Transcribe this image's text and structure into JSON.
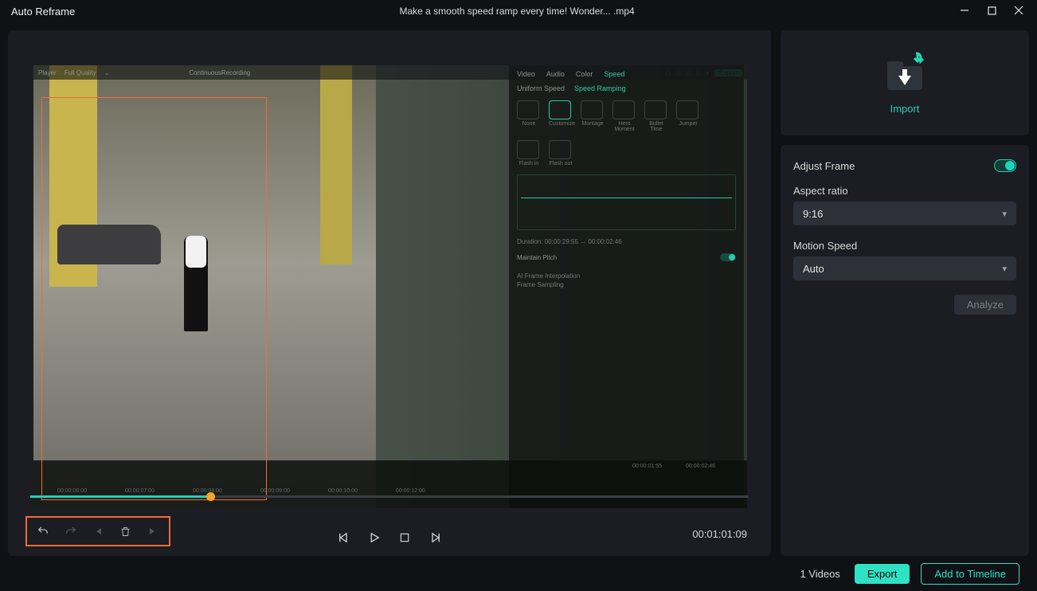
{
  "titlebar": {
    "app": "Auto Reframe",
    "filename": "Make a smooth speed ramp every time!  Wonder... .mp4"
  },
  "import": {
    "label": "Import"
  },
  "settings": {
    "adjust_frame_label": "Adjust Frame",
    "aspect_ratio_label": "Aspect ratio",
    "aspect_ratio_value": "9:16",
    "motion_speed_label": "Motion Speed",
    "motion_speed_value": "Auto",
    "analyze_label": "Analyze"
  },
  "playback": {
    "timecode": "00:01:01:09"
  },
  "inner_panel": {
    "top_left": "ContinuousRecording",
    "player_label": "Player",
    "quality_label": "Full Quality",
    "export_label": "Export",
    "tabs": {
      "video": "Video",
      "audio": "Audio",
      "color": "Color",
      "speed": "Speed"
    },
    "subtabs": {
      "uniform": "Uniform Speed",
      "ramping": "Speed Ramping"
    },
    "presets": [
      "None",
      "Customize",
      "Montage",
      "Hero Moment",
      "Bullet Time",
      "Jumper",
      "Flash in",
      "Flash out"
    ],
    "duration": "Duration: 00:00:29:55 → 00:00:02:46",
    "pitch": "Maintain Pitch",
    "interp_label": "AI Frame Interpolation",
    "interp_value": "Frame Sampling",
    "timestamps": [
      "00:00:06:00",
      "00:00:07:00",
      "00:00:08:00",
      "00:00:09:00",
      "00:00:10:00",
      "00:00:12:00"
    ],
    "clip_time_a": "00:00:01:55",
    "clip_time_b": "00:00:02:46"
  },
  "footer": {
    "count": "1 Videos",
    "export": "Export",
    "add": "Add to Timeline"
  }
}
